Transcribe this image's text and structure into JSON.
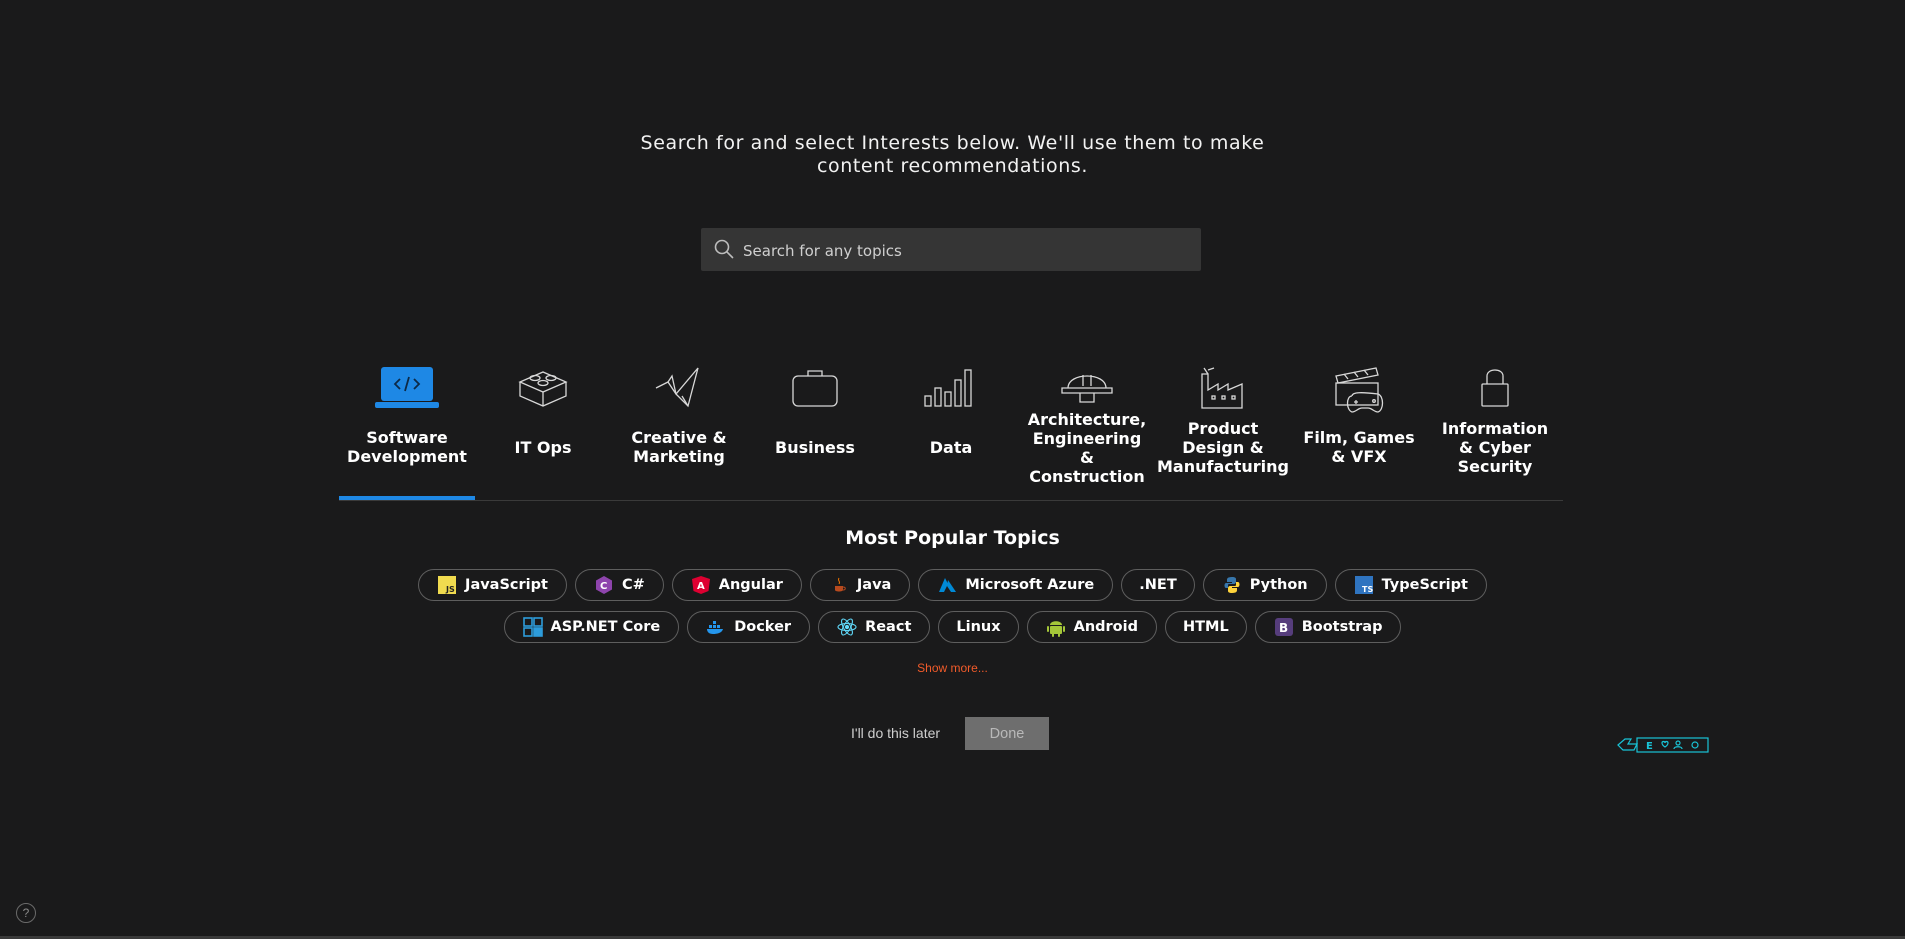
{
  "intro": {
    "line1": "Search for and select Interests below. We'll use them to make",
    "line2": "content recommendations."
  },
  "search": {
    "placeholder": "Search for any topics",
    "icon": "search-icon"
  },
  "categories": [
    {
      "label_lines": [
        "Software",
        "Development"
      ],
      "icon": "laptop-code-icon",
      "active": true
    },
    {
      "label_lines": [
        "IT Ops"
      ],
      "icon": "server-blocks-icon",
      "active": false
    },
    {
      "label_lines": [
        "Creative &",
        "Marketing"
      ],
      "icon": "origami-bird-icon",
      "active": false
    },
    {
      "label_lines": [
        "Business"
      ],
      "icon": "briefcase-icon",
      "active": false
    },
    {
      "label_lines": [
        "Data"
      ],
      "icon": "bar-chart-icon",
      "active": false
    },
    {
      "label_lines": [
        "Architecture,",
        "Engineering",
        "&",
        "Construction"
      ],
      "icon": "hard-hat-icon",
      "active": false
    },
    {
      "label_lines": [
        "Product",
        "Design &",
        "Manufacturing"
      ],
      "icon": "factory-icon",
      "active": false
    },
    {
      "label_lines": [
        "Film, Games",
        "& VFX"
      ],
      "icon": "clapper-gamepad-icon",
      "active": false
    },
    {
      "label_lines": [
        "Information",
        "& Cyber",
        "Security"
      ],
      "icon": "padlock-icon",
      "active": false
    }
  ],
  "popular": {
    "title": "Most Popular Topics",
    "row1": [
      {
        "label": "JavaScript",
        "icon": "javascript-icon"
      },
      {
        "label": "C#",
        "icon": "csharp-icon"
      },
      {
        "label": "Angular",
        "icon": "angular-icon"
      },
      {
        "label": "Java",
        "icon": "java-icon"
      },
      {
        "label": "Microsoft Azure",
        "icon": "azure-icon"
      },
      {
        "label": ".NET",
        "icon": ""
      },
      {
        "label": "Python",
        "icon": "python-icon"
      },
      {
        "label": "TypeScript",
        "icon": "typescript-icon"
      }
    ],
    "row2": [
      {
        "label": "ASP.NET Core",
        "icon": "aspnet-core-icon"
      },
      {
        "label": "Docker",
        "icon": "docker-icon"
      },
      {
        "label": "React",
        "icon": "react-icon"
      },
      {
        "label": "Linux",
        "icon": ""
      },
      {
        "label": "Android",
        "icon": "android-icon"
      },
      {
        "label": "HTML",
        "icon": ""
      },
      {
        "label": "Bootstrap",
        "icon": "bootstrap-icon"
      }
    ],
    "show_more": "Show more..."
  },
  "actions": {
    "later": "I'll do this later",
    "done": "Done"
  },
  "help": {
    "glyph": "?"
  },
  "colors": {
    "accent": "#1e88e5",
    "link": "#f15b2a",
    "background": "#1a1a1b"
  }
}
